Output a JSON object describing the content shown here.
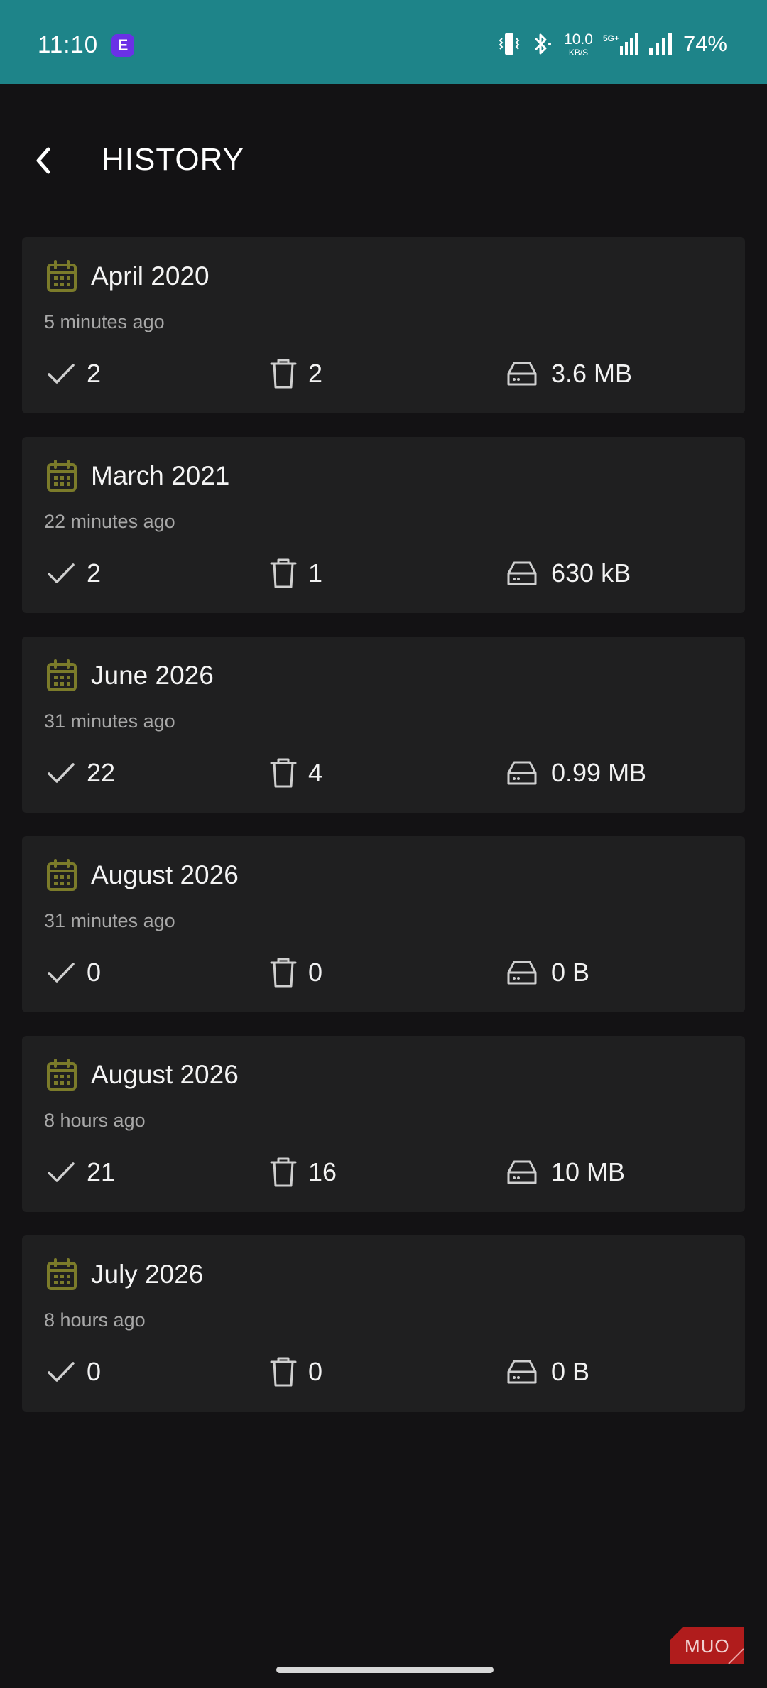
{
  "status_bar": {
    "time": "11:10",
    "app_badge": "E",
    "net_speed_value": "10.0",
    "net_speed_unit": "KB/S",
    "network_type": "5G+",
    "battery": "74%"
  },
  "header": {
    "title": "HISTORY"
  },
  "history": [
    {
      "title": "April 2020",
      "time": "5 minutes ago",
      "done": "2",
      "deleted": "2",
      "size": "3.6 MB"
    },
    {
      "title": "March 2021",
      "time": "22 minutes ago",
      "done": "2",
      "deleted": "1",
      "size": "630 kB"
    },
    {
      "title": "June 2026",
      "time": "31 minutes ago",
      "done": "22",
      "deleted": "4",
      "size": "0.99 MB"
    },
    {
      "title": "August 2026",
      "time": "31 minutes ago",
      "done": "0",
      "deleted": "0",
      "size": "0 B"
    },
    {
      "title": "August 2026",
      "time": "8 hours ago",
      "done": "21",
      "deleted": "16",
      "size": "10 MB"
    },
    {
      "title": "July 2026",
      "time": "8 hours ago",
      "done": "0",
      "deleted": "0",
      "size": "0 B"
    }
  ],
  "watermark": "MUO",
  "colors": {
    "status_bar": "#1e8489",
    "background": "#131214",
    "card": "#1f1f20",
    "calendar_icon": "#7b7b2a",
    "secondary_text": "#a7a7a7",
    "watermark": "#b01c1c"
  },
  "icons": {
    "back": "chevron-left-icon",
    "calendar": "calendar-icon",
    "done": "check-icon",
    "deleted": "trash-icon",
    "size": "hard-drive-icon"
  }
}
